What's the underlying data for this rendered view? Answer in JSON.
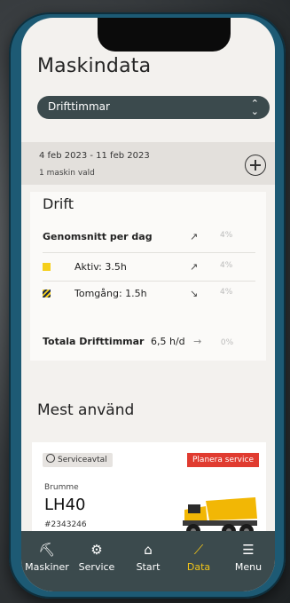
{
  "app": {
    "title": "Maskindata"
  },
  "filter": {
    "selected": "Drifttimmar"
  },
  "period": {
    "range": "4 feb 2023 - 11 feb 2023",
    "machines": "1 maskin vald"
  },
  "drift": {
    "heading": "Drift",
    "avg_label": "Genomsnitt per dag",
    "avg_arrow": "↗",
    "avg_pct": "4%",
    "rows": [
      {
        "label": "Aktiv: 3.5h",
        "arrow": "↗",
        "pct": "4%"
      },
      {
        "label": "Tomgång: 1.5h",
        "arrow": "↘",
        "pct": "4%"
      }
    ],
    "total_label": "Totala Drifttimmar",
    "total_value": "6,5 h/d",
    "total_arrow": "→",
    "total_pct": "0%"
  },
  "most_used": {
    "heading": "Mest använd",
    "badge": "Serviceavtal",
    "plan_button": "Planera service",
    "name": "Brumme",
    "model": "LH40",
    "serial": "#2343246"
  },
  "nav": {
    "items": [
      {
        "label": "Maskiner",
        "icon": "excavator-icon"
      },
      {
        "label": "Service",
        "icon": "service-icon"
      },
      {
        "label": "Start",
        "icon": "home-icon"
      },
      {
        "label": "Data",
        "icon": "chart-icon"
      },
      {
        "label": "Menu",
        "icon": "menu-icon"
      }
    ],
    "active": "Data"
  },
  "colors": {
    "accent": "#f0c419",
    "nav_bg": "#3b4a4d",
    "danger": "#e03b30"
  }
}
